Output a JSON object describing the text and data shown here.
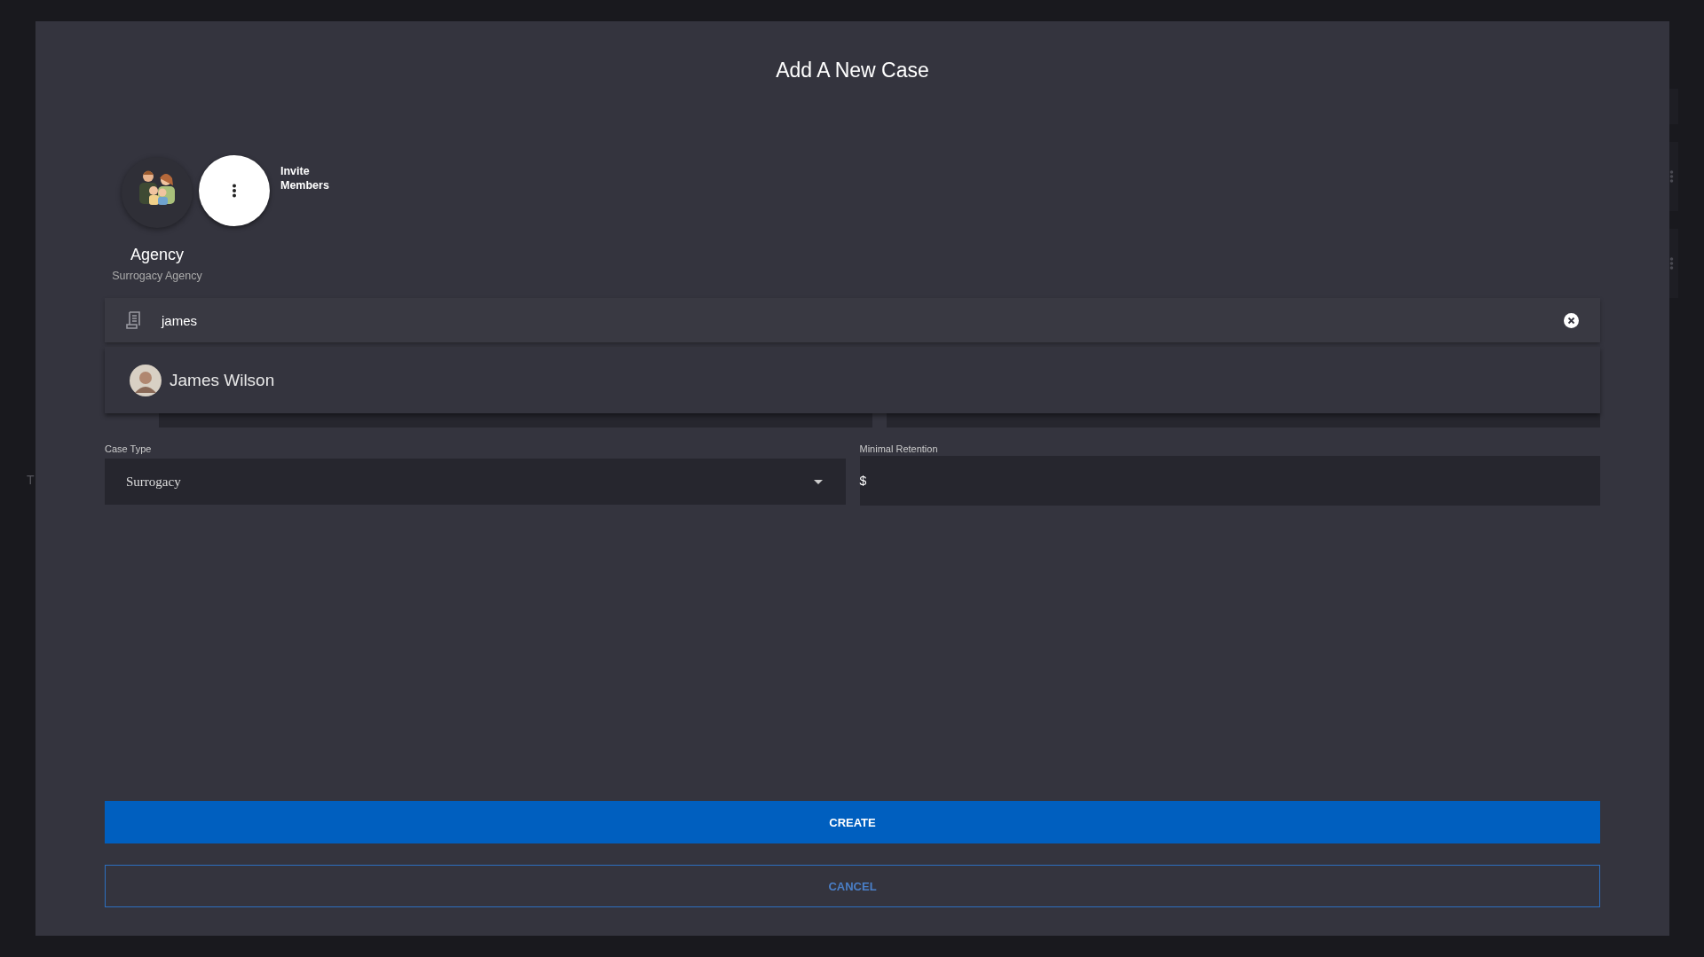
{
  "background": {
    "text": "T"
  },
  "dialog": {
    "title": "Add A New Case",
    "agency": {
      "name": "Agency",
      "subtitle": "Surrogacy Agency"
    },
    "invite": {
      "label": "Invite Members"
    },
    "search": {
      "value": "james"
    },
    "suggestions": [
      {
        "name": "James Wilson"
      }
    ],
    "case_type": {
      "label": "Case Type",
      "value": "Surrogacy"
    },
    "retention": {
      "label": "Minimal Retention",
      "prefix": "$"
    },
    "buttons": [
      {
        "label": "CREATE",
        "kind": "primary"
      },
      {
        "label": "CANCEL",
        "kind": "outline"
      }
    ]
  }
}
